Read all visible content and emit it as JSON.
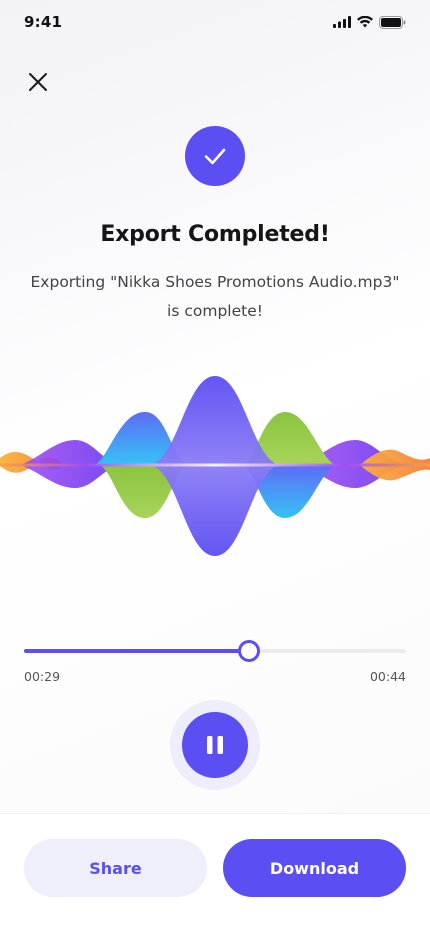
{
  "status_bar": {
    "time": "9:41"
  },
  "header": {
    "close_icon": "close-icon"
  },
  "success": {
    "icon": "check-icon",
    "title": "Export Completed!",
    "message_line1": "Exporting \"Nikka Shoes Promotions Audio.mp3\"",
    "message_line2": "is complete!"
  },
  "player": {
    "current_time": "00:29",
    "total_time": "00:44",
    "progress": 0.59,
    "state_icon": "pause-icon"
  },
  "actions": {
    "share_label": "Share",
    "download_label": "Download"
  },
  "colors": {
    "accent": "#5b4ef2",
    "accent_soft": "#efeefb",
    "wave_purple": "#7b3df0",
    "wave_blue": "#3aa2f5",
    "wave_green": "#8bc43f",
    "wave_orange": "#f9a23a"
  }
}
